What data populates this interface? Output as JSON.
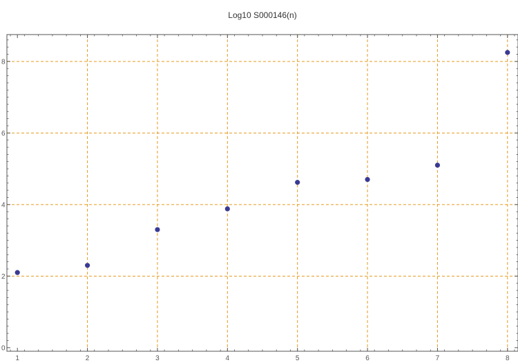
{
  "chart_data": {
    "type": "scatter",
    "title": "Log10 S000146(n)",
    "xlabel": "",
    "ylabel": "",
    "x": [
      1,
      2,
      3,
      4,
      5,
      6,
      7,
      8
    ],
    "y": [
      2.1,
      2.3,
      3.3,
      3.88,
      4.62,
      4.7,
      5.1,
      8.25
    ],
    "xlim": [
      0.85,
      8.15
    ],
    "ylim": [
      -0.1,
      8.75
    ],
    "x_ticks": [
      1,
      2,
      3,
      4,
      5,
      6,
      7,
      8
    ],
    "y_ticks": [
      0,
      2,
      4,
      6,
      8
    ],
    "y_tick_labels": [
      "0",
      "2",
      "4",
      "6",
      "8"
    ],
    "grid": true,
    "colors": {
      "points": "#3a3a94",
      "grid": "#e69a1f",
      "frame": "#555555"
    }
  }
}
